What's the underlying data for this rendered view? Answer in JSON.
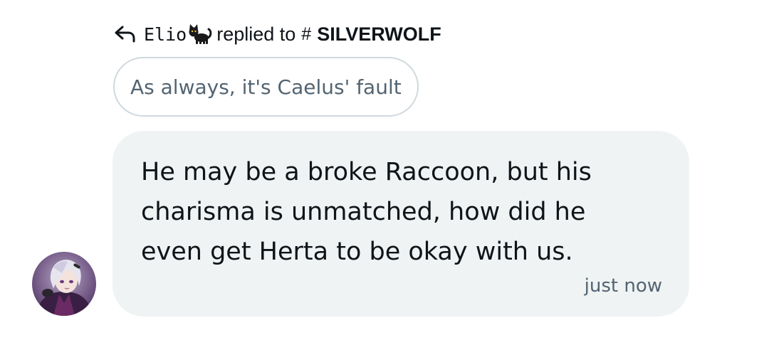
{
  "reply_header": {
    "author": "Elio",
    "author_badge_icon": "black-cat-emoji",
    "action_text": "replied to",
    "hash_symbol": "#",
    "channel": "SILVERWOLF"
  },
  "quoted_message": {
    "text": "As always, it's Caelus' fault"
  },
  "message": {
    "text": "He may be a broke Raccoon, but his charisma is unmatched, how did he even get Herta to be okay with us.",
    "timestamp": "just now",
    "sender_avatar_icon": "avatar-silver-haired-character"
  },
  "colors": {
    "bubble_bg": "#eff3f4",
    "pill_border": "#cfd9de",
    "muted_text": "#536471",
    "main_text": "#0f1419"
  }
}
